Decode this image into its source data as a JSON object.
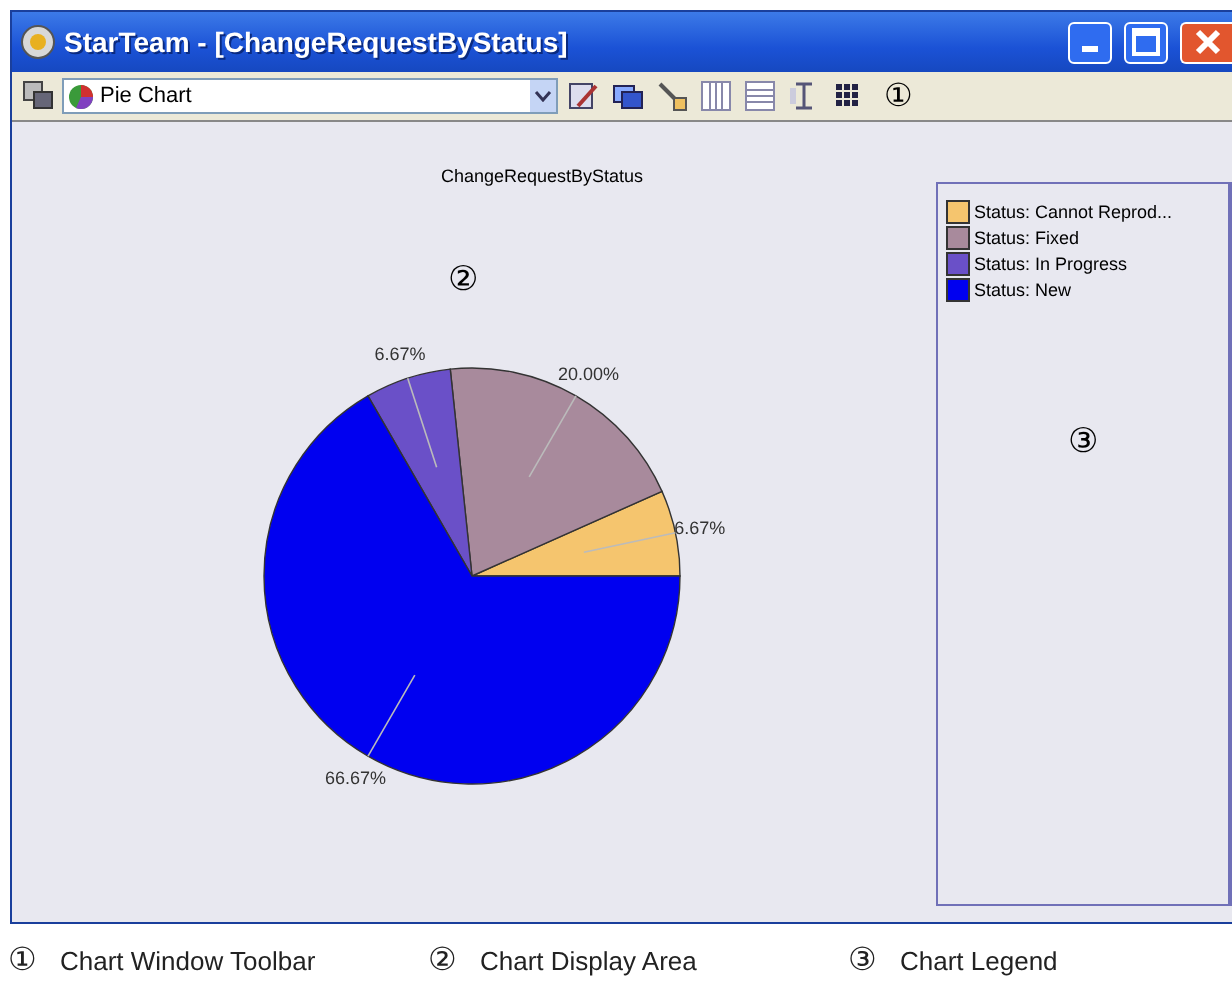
{
  "window": {
    "title": "StarTeam - [ChangeRequestByStatus]"
  },
  "toolbar": {
    "chart_type": "Pie Chart",
    "marker": "①"
  },
  "chart": {
    "marker": "②",
    "chart_data": {
      "type": "pie",
      "title": "ChangeRequestByStatus",
      "categories": [
        "Status: Cannot Reprod...",
        "Status: Fixed",
        "Status: In Progress",
        "Status: New"
      ],
      "values": [
        6.67,
        20.0,
        6.67,
        66.67
      ],
      "colors": [
        "#f5c56e",
        "#a88a9c",
        "#6a50c8",
        "#0000f0"
      ],
      "legend": "right",
      "value_labels": [
        "6.67%",
        "20.00%",
        "6.67%",
        "66.67%"
      ]
    }
  },
  "legend": {
    "marker": "③"
  },
  "captions": [
    {
      "marker": "①",
      "label": "Chart Window Toolbar"
    },
    {
      "marker": "②",
      "label": "Chart Display Area"
    },
    {
      "marker": "③",
      "label": "Chart Legend"
    }
  ]
}
